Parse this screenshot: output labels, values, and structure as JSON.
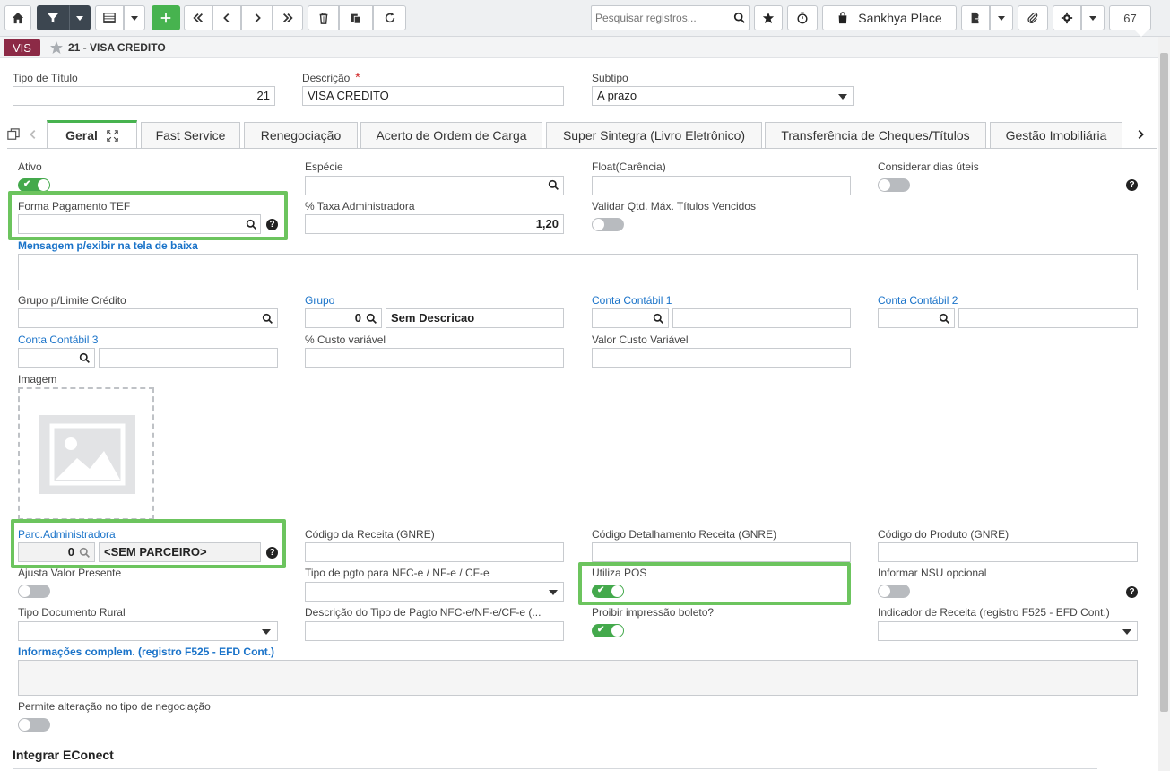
{
  "toolbar": {
    "search_placeholder": "Pesquisar registros...",
    "place_label": "Sankhya Place",
    "counter": "67"
  },
  "breadcrumb": {
    "badge": "VIS",
    "title": "21 - VISA CREDITO"
  },
  "header": {
    "tipo_titulo_label": "Tipo de Título",
    "tipo_titulo_value": "21",
    "descricao_label": "Descrição",
    "descricao_required": "*",
    "descricao_value": "VISA CREDITO",
    "subtipo_label": "Subtipo",
    "subtipo_value": "A prazo"
  },
  "tabs": [
    {
      "label": "Geral"
    },
    {
      "label": "Fast Service"
    },
    {
      "label": "Renegociação"
    },
    {
      "label": "Acerto de Ordem de Carga"
    },
    {
      "label": "Super Sintegra (Livro Eletrônico)"
    },
    {
      "label": "Transferência de Cheques/Títulos"
    },
    {
      "label": "Gestão Imobiliária"
    }
  ],
  "form": {
    "ativo": {
      "label": "Ativo",
      "on": true
    },
    "especie": {
      "label": "Espécie",
      "value": ""
    },
    "float": {
      "label": "Float(Carência)",
      "value": ""
    },
    "dias_uteis": {
      "label": "Considerar dias úteis",
      "on": false
    },
    "forma_pagto_tef": {
      "label": "Forma Pagamento TEF",
      "value": ""
    },
    "taxa_admin": {
      "label": "% Taxa Administradora",
      "value": "1,20"
    },
    "validar_qtd": {
      "label": "Validar Qtd. Máx. Títulos Vencidos",
      "on": false
    },
    "mensagem": {
      "label": "Mensagem p/exibir na tela de baixa",
      "value": ""
    },
    "grupo_limite": {
      "label": "Grupo p/Limite Crédito",
      "value": ""
    },
    "grupo": {
      "label": "Grupo",
      "code": "0",
      "desc": "Sem Descricao"
    },
    "conta1": {
      "label": "Conta Contábil 1",
      "code": "",
      "desc": ""
    },
    "conta2": {
      "label": "Conta Contábil 2",
      "code": "",
      "desc": ""
    },
    "conta3": {
      "label": "Conta Contábil 3",
      "code": "",
      "desc": ""
    },
    "custo_var": {
      "label": "% Custo variável",
      "value": ""
    },
    "valor_custo": {
      "label": "Valor Custo Variável",
      "value": ""
    },
    "imagem": {
      "label": "Imagem"
    },
    "parc_admin": {
      "label": "Parc.Administradora",
      "code": "0",
      "desc": "<SEM PARCEIRO>"
    },
    "cod_receita": {
      "label": "Código da Receita (GNRE)",
      "value": ""
    },
    "cod_detalhe": {
      "label": "Código Detalhamento Receita (GNRE)",
      "value": ""
    },
    "cod_produto": {
      "label": "Código do Produto (GNRE)",
      "value": ""
    },
    "ajusta_valor": {
      "label": "Ajusta Valor Presente",
      "on": false
    },
    "tipo_pgto_nfce": {
      "label": "Tipo de pgto para NFC-e / NF-e / CF-e",
      "value": ""
    },
    "utiliza_pos": {
      "label": "Utiliza POS",
      "on": true
    },
    "nsu_opcional": {
      "label": "Informar NSU opcional",
      "on": false
    },
    "tipo_doc_rural": {
      "label": "Tipo Documento Rural",
      "value": ""
    },
    "desc_tipo_pagto": {
      "label": "Descrição do Tipo de Pagto NFC-e/NF-e/CF-e (...",
      "value": ""
    },
    "proibir_boleto": {
      "label": "Proibir impressão boleto?",
      "on": true
    },
    "indicador_receita": {
      "label": "Indicador de Receita (registro F525 - EFD Cont.)",
      "value": ""
    },
    "info_complem": {
      "label": "Informações complem. (registro F525 - EFD Cont.)",
      "value": ""
    },
    "permite_alteracao": {
      "label": "Permite alteração no tipo de negociação",
      "on": false
    },
    "integrar_section": "Integrar EConect"
  },
  "colors": {
    "accent": "#47b34f",
    "highlight": "#6cc45e",
    "badge": "#8c2a46",
    "link": "#1a73c9"
  }
}
